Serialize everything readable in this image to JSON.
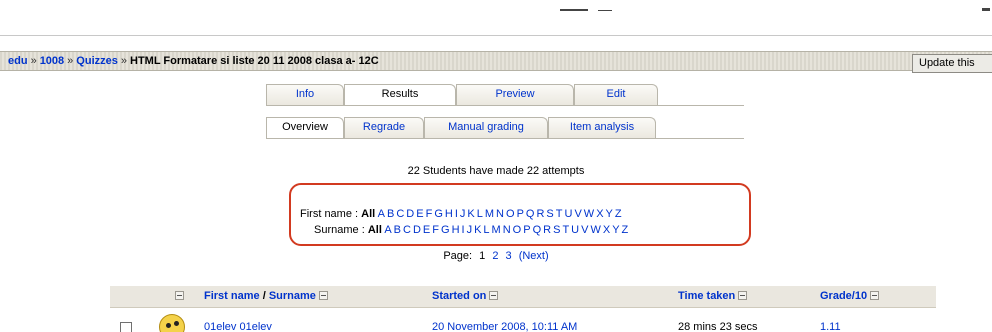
{
  "breadcrumb": {
    "items": [
      "edu",
      "1008",
      "Quizzes"
    ],
    "separator": "»",
    "current": "HTML Formatare si liste 20 11 2008 clasa a- 12C"
  },
  "update_button": {
    "label": "Update this"
  },
  "tabs_primary": [
    "Info",
    "Results",
    "Preview",
    "Edit"
  ],
  "tabs_secondary": [
    "Overview",
    "Regrade",
    "Manual grading",
    "Item analysis"
  ],
  "summary": "22 Students have made 22 attempts",
  "filters": {
    "first_name_label": "First name :",
    "surname_label": "Surname :",
    "all_label": "All",
    "letters": [
      "A",
      "B",
      "C",
      "D",
      "E",
      "F",
      "G",
      "H",
      "I",
      "J",
      "K",
      "L",
      "M",
      "N",
      "O",
      "P",
      "Q",
      "R",
      "S",
      "T",
      "U",
      "V",
      "W",
      "X",
      "Y",
      "Z"
    ]
  },
  "pager": {
    "label": "Page:",
    "current": "1",
    "pages": [
      "2",
      "3"
    ],
    "next": "(Next)"
  },
  "table": {
    "headers": {
      "name_first": "First name",
      "name_slash": " / ",
      "name_last": "Surname",
      "started": "Started on",
      "time_taken": "Time taken",
      "grade": "Grade/10"
    },
    "rows": [
      {
        "name": "01elev 01elev",
        "started": "20 November 2008, 10:11 AM",
        "time": "28 mins 23 secs",
        "grade": "1.11"
      }
    ]
  },
  "colors": {
    "link": "#0033cc",
    "highlight_box": "#d23a20",
    "navbar": "#dedbd2"
  }
}
